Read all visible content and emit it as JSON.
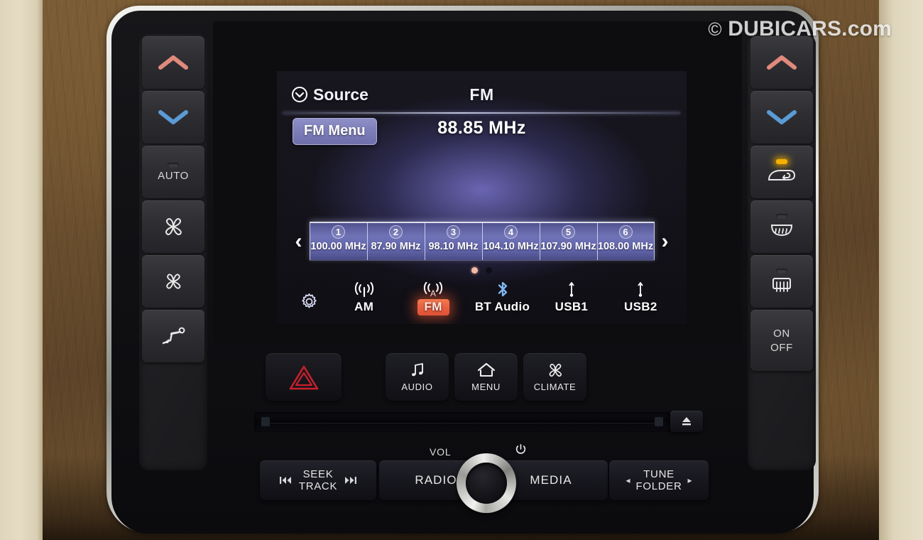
{
  "watermark": {
    "copyright": "©",
    "text": "DUBICARS.com"
  },
  "screen": {
    "source_label": "Source",
    "source_icon": "chevron-down-circle-icon",
    "title": "FM",
    "fm_menu_label": "FM Menu",
    "frequency": "88.85 MHz",
    "prev_arrow": "‹",
    "next_arrow": "›",
    "presets": [
      {
        "number": "1",
        "freq": "100.00 MHz"
      },
      {
        "number": "2",
        "freq": "87.90 MHz"
      },
      {
        "number": "3",
        "freq": "98.10 MHz"
      },
      {
        "number": "4",
        "freq": "104.10 MHz"
      },
      {
        "number": "5",
        "freq": "107.90 MHz"
      },
      {
        "number": "6",
        "freq": "108.00 MHz"
      }
    ],
    "page_dots": [
      {
        "state": "active"
      },
      {
        "state": "idle"
      }
    ],
    "settings_icon": "gear-icon",
    "sources": [
      {
        "label": "AM",
        "icon": "am-antenna-icon",
        "active": false
      },
      {
        "label": "FM",
        "icon": "fm-antenna-icon",
        "active": true
      },
      {
        "label": "BT Audio",
        "icon": "bluetooth-icon",
        "active": false
      },
      {
        "label": "USB1",
        "icon": "usb-icon",
        "active": false
      },
      {
        "label": "USB2",
        "icon": "usb-icon",
        "active": false
      }
    ],
    "colors": {
      "accent_active": "#ea5c3c",
      "preset_tile": "#6f72b6",
      "fm_menu": "#7c7db9",
      "screen_glow": "#7873cd"
    }
  },
  "left_climate_column": [
    {
      "label": "",
      "icon": "temp-up-chevron-icon",
      "tint": "#e08a7c"
    },
    {
      "label": "",
      "icon": "temp-down-chevron-icon",
      "tint": "#5b9bd5"
    },
    {
      "label": "AUTO",
      "icon": "led-indicator",
      "tint": "#cfcfcf"
    },
    {
      "label": "",
      "icon": "fan-up-icon",
      "tint": "#e8e8e8"
    },
    {
      "label": "",
      "icon": "fan-down-icon",
      "tint": "#e8e8e8"
    },
    {
      "label": "",
      "icon": "airflow-mode-icon",
      "tint": "#e8e8e8"
    }
  ],
  "right_climate_column": [
    {
      "label": "",
      "icon": "temp-up-chevron-icon",
      "tint": "#e08a7c"
    },
    {
      "label": "",
      "icon": "temp-down-chevron-icon",
      "tint": "#5b9bd5"
    },
    {
      "label": "",
      "icon": "air-recirculation-icon",
      "led": "on",
      "led_color": "#f5b000"
    },
    {
      "label": "",
      "icon": "front-defrost-icon",
      "led": "off"
    },
    {
      "label": "",
      "icon": "rear-defrost-icon",
      "led": "off"
    },
    {
      "label_line1": "ON",
      "label_line2": "OFF",
      "icon": "power-onoff-label"
    }
  ],
  "hard_keys": [
    {
      "label": "",
      "icon": "hazard-triangle-icon",
      "name": "hazard-button"
    },
    {
      "label": "AUDIO",
      "icon": "music-note-icon",
      "name": "audio-button"
    },
    {
      "label": "MENU",
      "icon": "home-icon",
      "name": "menu-button"
    },
    {
      "label": "CLIMATE",
      "icon": "fan-icon",
      "name": "climate-button"
    }
  ],
  "bottom_bar": {
    "seek": {
      "line1": "SEEK",
      "line2": "TRACK",
      "prev_icon": "⏮",
      "next_icon": "⏭"
    },
    "radio": "RADIO",
    "media": "MEDIA",
    "tune": {
      "line1": "TUNE",
      "line2": "FOLDER",
      "left_icon": "◂",
      "right_icon": "▸"
    },
    "vol_label": "VOL",
    "power_icon": "⏻",
    "knob": "volume-knob"
  },
  "cd": {
    "eject_icon": "⏏"
  }
}
